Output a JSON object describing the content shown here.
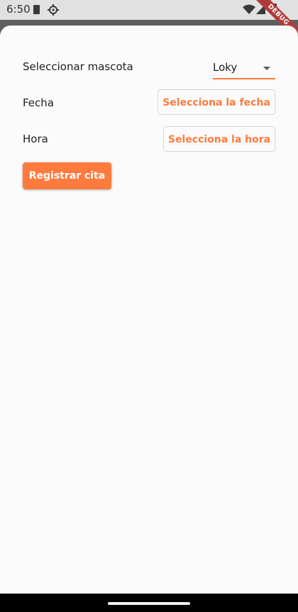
{
  "status_bar": {
    "time": "6:50",
    "icons": [
      "sd-card-icon",
      "gear-icon",
      "wifi-icon",
      "signal-icon",
      "battery-icon"
    ]
  },
  "debug_banner": "DEBUG",
  "form": {
    "pet_label": "Seleccionar mascota",
    "pet_value": "Loky",
    "date_label": "Fecha",
    "date_button": "Selecciona la fecha",
    "time_label": "Hora",
    "time_button": "Selecciona la hora",
    "submit_button": "Registrar cita"
  },
  "colors": {
    "accent": "#ff7a3d",
    "background": "#fbfbfb",
    "status_bar": "#e1e1e1"
  }
}
